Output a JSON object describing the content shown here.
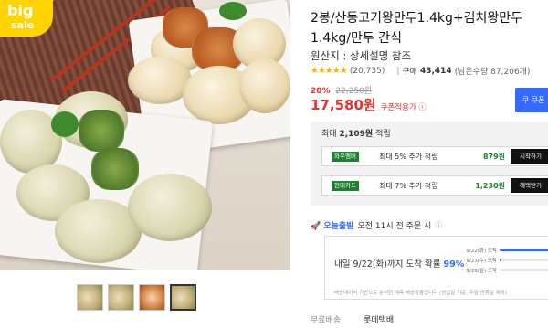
{
  "badge": {
    "line1": "big",
    "line2": "sale"
  },
  "product": {
    "title": "2봉/산동고기왕만두1.4kg+김치왕만두1.4kg/만두 간식",
    "origin": "원산지 : 상세설명 참조",
    "rating_stars": "★★★★★",
    "rating_value": 4.5,
    "review_count": "(20,735)",
    "purchase_label": "구매",
    "purchase_count": "43,414",
    "purchase_note": "(남은수량 87,206개)"
  },
  "pricing": {
    "discount_pct": "20%",
    "original_price": "22,250원",
    "sale_price": "17,580원",
    "coupon_label": "쿠폰적용가 ⓘ",
    "buy_button": "쿠 쿠폰"
  },
  "reward": {
    "header_prefix": "최대",
    "header_amount": "2,109원",
    "header_suffix": "적립",
    "rows": [
      {
        "tag": "와우멤버",
        "text": "최대 5% 추가 적립",
        "points": "879원",
        "action": "시작하기"
      },
      {
        "tag": "현대카드",
        "text": "최대 7% 추가 적립",
        "points": "1,230원",
        "action": "혜택받기"
      }
    ]
  },
  "delivery": {
    "badge": "🚀 오늘출발",
    "text": "오전 11시 전 주문 시",
    "info_icon": "info-icon",
    "arrival_prefix": "내일 9/22(화)까지 도착 확률",
    "arrival_pct": "99%",
    "bars": [
      {
        "date": "9/22(화) 도착",
        "fraction": 0.99
      },
      {
        "date": "9/23(수) 도착",
        "fraction": 0.01
      },
      {
        "date": "9/28(월) 도착",
        "fraction": 0.0
      }
    ],
    "note": "배송데이터 기반으로 분석한 예측 배송확률입니다 (영업일 기준, 주말/공휴일 제외)"
  },
  "shipping": {
    "label": "무료배송",
    "carrier": "롯데택배"
  },
  "colors": {
    "accent": "#346aff",
    "price_red": "#e5322d",
    "reward_green": "#1d7f2f"
  }
}
